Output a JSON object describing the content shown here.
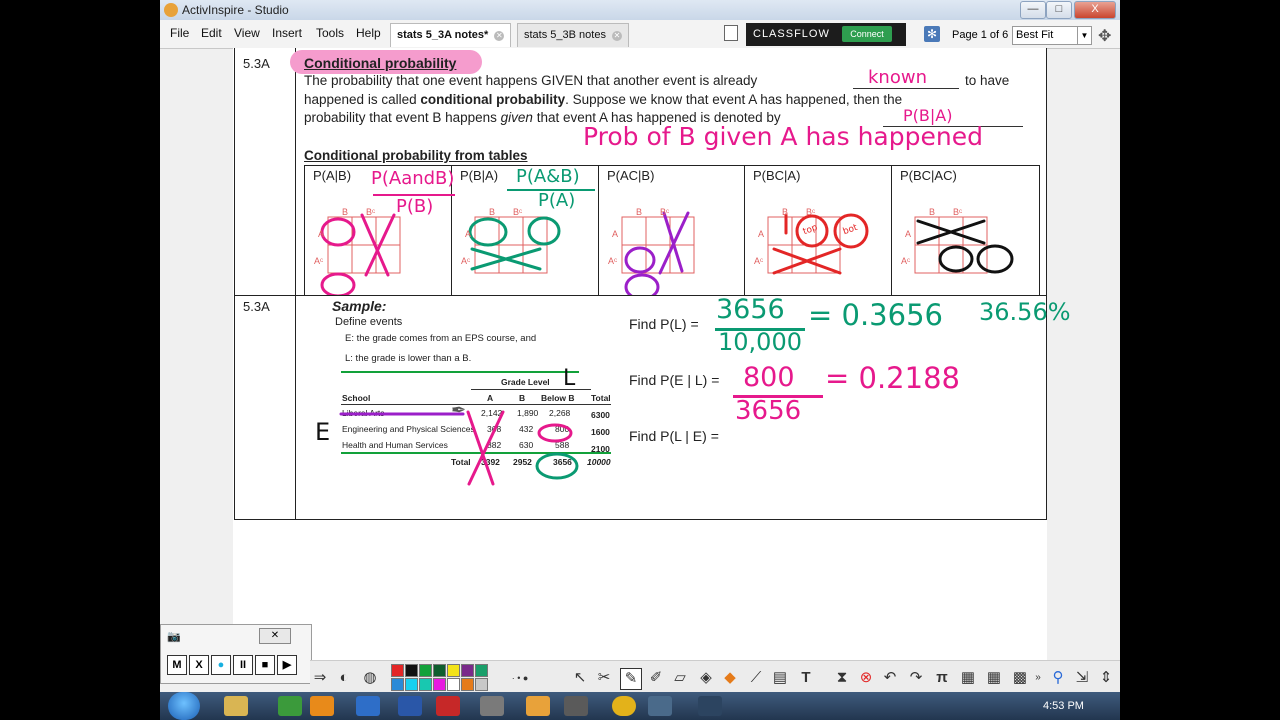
{
  "window": {
    "title": "ActivInspire - Studio",
    "controls": [
      "—",
      "□",
      "X"
    ]
  },
  "menu": [
    "File",
    "Edit",
    "View",
    "Insert",
    "Tools",
    "Help"
  ],
  "tabs": [
    {
      "label": "stats 5_3A notes*",
      "active": true
    },
    {
      "label": "stats 5_3B notes",
      "active": false
    }
  ],
  "classflow": {
    "brand": "CLASSFLOW",
    "connect": "Connect"
  },
  "page": {
    "indicator": "Page 1 of 6",
    "fit": "Best Fit"
  },
  "sections": [
    {
      "number": "5.3A",
      "title": "Conditional probability",
      "line1_a": "The probability that one event happens GIVEN that another event is already",
      "line1_b": "to have",
      "line2_a": "happened is called",
      "line2_b": "conditional probability",
      "line2_c": ". Suppose we know that event A has happened, then the",
      "line3_a": "probability that event B happens",
      "line3_b": "given",
      "line3_c": "that event A has happened is denoted by",
      "subheading": "Conditional probability from tables",
      "cells": [
        "P(A|B)",
        "P(B|A)",
        "P(AC|B)",
        "P(BC|A)",
        "P(BC|AC)"
      ]
    },
    {
      "number": "5.3A",
      "sample_label": "Sample:",
      "define": "Define events",
      "event_e": "E: the grade comes from an EPS course, and",
      "event_l": "L: the grade is lower than a B.",
      "table": {
        "group_header": "Grade Level",
        "headers": [
          "School",
          "A",
          "B",
          "Below B",
          "Total"
        ],
        "rows": [
          [
            "Liberal Arts",
            "2,142",
            "1,890",
            "2,268",
            "6300"
          ],
          [
            "Engineering and Physical Sciences",
            "368",
            "432",
            "800",
            "1600"
          ],
          [
            "Health and Human Services",
            "882",
            "630",
            "588",
            "2100"
          ],
          [
            "Total",
            "3392",
            "2952",
            "3656",
            "10000"
          ]
        ]
      },
      "finds": [
        "Find P(L) =",
        "Find P(E | L) =",
        "Find P(L | E) ="
      ]
    }
  ],
  "annotations": {
    "blank_known": "known",
    "notation": "P(B|A)",
    "prob_note": "Prob of B given A has happened",
    "formula1_num": "P(AandB)",
    "formula1_den": "P(B)",
    "formula2_num": "P(A&B)",
    "formula2_den": "P(A)",
    "top": "top",
    "bot": "bot",
    "l_letter": "L",
    "e_letter": "E",
    "pl_num": "3656",
    "pl_den": "10,000",
    "pl_eq": "= 0.3656",
    "pl_pct": "36.56%",
    "pel_num": "800",
    "pel_den": "3656",
    "pel_eq": "= 0.2188"
  },
  "palette_buttons": [
    "M",
    "X",
    "●",
    "II",
    "■",
    "▶"
  ],
  "colors": {
    "pink": "#e6198c",
    "green": "#0a9a72",
    "purple": "#9b1fc9",
    "red": "#e32626",
    "highlight": "#f59ccd"
  },
  "swatches": [
    "#e32626",
    "#111111",
    "#12a13a",
    "#0e5e2e",
    "#f3e319",
    "#7a2a8a",
    "#1a9f6a",
    "#2a8ad8",
    "#18d0f0",
    "#18c8b0",
    "#e61ae0",
    "#ffffff",
    "#e57b1a",
    "#c8c8c8",
    "#8c8c8c",
    "#6a6a6a"
  ],
  "clock": "4:53 PM"
}
